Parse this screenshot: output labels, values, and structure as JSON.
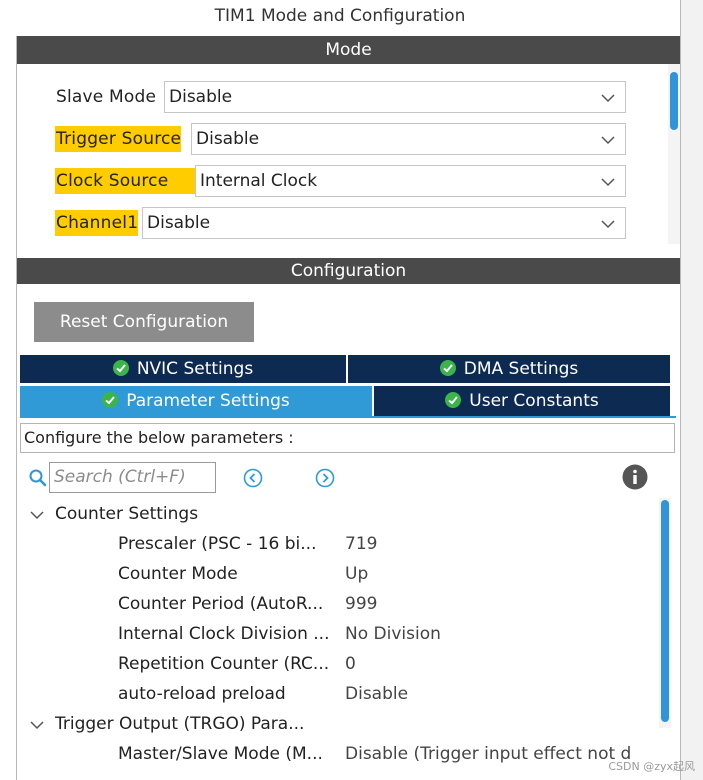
{
  "window": {
    "title": "TIM1 Mode and Configuration"
  },
  "mode_section": {
    "title": "Mode",
    "fields": [
      {
        "label": "Slave Mode",
        "value": "Disable",
        "highlight": false
      },
      {
        "label": "Trigger Source",
        "value": "Disable",
        "highlight": true
      },
      {
        "label": "Clock Source",
        "value": "Internal Clock",
        "highlight": true
      },
      {
        "label": "Channel1",
        "value": "Disable",
        "highlight": true
      }
    ]
  },
  "config_section": {
    "title": "Configuration",
    "reset_label": "Reset Configuration",
    "tabs": [
      {
        "label": "NVIC Settings",
        "active": false
      },
      {
        "label": "DMA Settings",
        "active": false
      },
      {
        "label": "Parameter Settings",
        "active": true
      },
      {
        "label": "User Constants",
        "active": false
      }
    ],
    "banner": "Configure the below parameters :",
    "search": {
      "placeholder": "Search (Ctrl+F)"
    },
    "groups": [
      {
        "name": "Counter Settings",
        "params": [
          {
            "name": "Prescaler (PSC - 16 bi...",
            "value": "719"
          },
          {
            "name": "Counter Mode",
            "value": "Up"
          },
          {
            "name": "Counter Period (AutoR...",
            "value": "999"
          },
          {
            "name": "Internal Clock Division ...",
            "value": "No Division"
          },
          {
            "name": "Repetition Counter (RC...",
            "value": "0"
          },
          {
            "name": "auto-reload preload",
            "value": "Disable"
          }
        ]
      },
      {
        "name": "Trigger Output (TRGO) Para...",
        "params": [
          {
            "name": "Master/Slave Mode (M...",
            "value": "Disable (Trigger input effect not d"
          }
        ]
      }
    ]
  },
  "colors": {
    "highlight": "#ffcc00",
    "section_bar": "#4a4a4a",
    "tab_dark": "#0c2a52",
    "tab_active": "#2f9ad6",
    "scroll_thumb": "#2f95d8",
    "check_green": "#3bb54a"
  },
  "icons": {
    "select_arrow": "chevron-down-icon",
    "tab_status": "check-circle-icon",
    "search": "search-icon",
    "nav_prev": "arrow-left-circle-icon",
    "nav_next": "arrow-right-circle-icon",
    "info": "info-icon",
    "group_toggle": "chevron-down-icon"
  },
  "watermark": "CSDN @zyx起风"
}
